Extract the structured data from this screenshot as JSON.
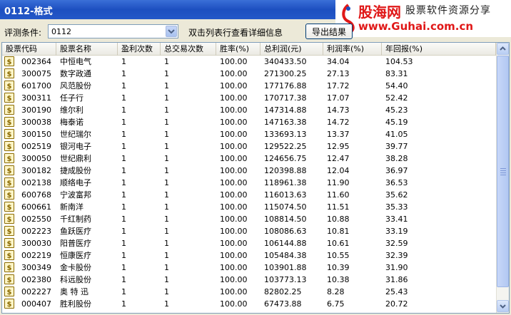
{
  "window": {
    "title": "0112-格式"
  },
  "watermark": {
    "brand": "股海网",
    "slogan": "股票软件资源分享",
    "url": "www.Guhai.com.cn"
  },
  "filter": {
    "label": "评测条件:",
    "value": "0112",
    "hint": "双击列表行查看详细信息"
  },
  "toolbar": {
    "export_label": "导出结果"
  },
  "table": {
    "columns": [
      "股票代码",
      "股票名称",
      "盈利次数",
      "总交易次数",
      "胜率(%)",
      "总利润(元)",
      "利润率(%)",
      "年回报(%)"
    ],
    "rows": [
      [
        "002364",
        "中恒电气",
        "1",
        "1",
        "100.00",
        "340433.50",
        "34.04",
        "104.53"
      ],
      [
        "300075",
        "数字政通",
        "1",
        "1",
        "100.00",
        "271300.25",
        "27.13",
        "83.31"
      ],
      [
        "601700",
        "风范股份",
        "1",
        "1",
        "100.00",
        "177176.88",
        "17.72",
        "54.40"
      ],
      [
        "300311",
        "任子行",
        "1",
        "1",
        "100.00",
        "170717.38",
        "17.07",
        "52.42"
      ],
      [
        "300190",
        "维尔利",
        "1",
        "1",
        "100.00",
        "147314.88",
        "14.73",
        "45.23"
      ],
      [
        "300038",
        "梅泰诺",
        "1",
        "1",
        "100.00",
        "147163.38",
        "14.72",
        "45.19"
      ],
      [
        "300150",
        "世纪瑞尔",
        "1",
        "1",
        "100.00",
        "133693.13",
        "13.37",
        "41.05"
      ],
      [
        "002519",
        "银河电子",
        "1",
        "1",
        "100.00",
        "129522.25",
        "12.95",
        "39.77"
      ],
      [
        "300050",
        "世纪鼎利",
        "1",
        "1",
        "100.00",
        "124656.75",
        "12.47",
        "38.28"
      ],
      [
        "300182",
        "捷成股份",
        "1",
        "1",
        "100.00",
        "120398.88",
        "12.04",
        "36.97"
      ],
      [
        "002138",
        "顺络电子",
        "1",
        "1",
        "100.00",
        "118961.38",
        "11.90",
        "36.53"
      ],
      [
        "600768",
        "宁波富邦",
        "1",
        "1",
        "100.00",
        "116013.63",
        "11.60",
        "35.62"
      ],
      [
        "600661",
        "新南洋",
        "1",
        "1",
        "100.00",
        "115074.50",
        "11.51",
        "35.33"
      ],
      [
        "002550",
        "千红制药",
        "1",
        "1",
        "100.00",
        "108814.50",
        "10.88",
        "33.41"
      ],
      [
        "002223",
        "鱼跃医疗",
        "1",
        "1",
        "100.00",
        "108086.63",
        "10.81",
        "33.19"
      ],
      [
        "300030",
        "阳普医疗",
        "1",
        "1",
        "100.00",
        "106144.88",
        "10.61",
        "32.59"
      ],
      [
        "002219",
        "恒康医疗",
        "1",
        "1",
        "100.00",
        "105484.38",
        "10.55",
        "32.39"
      ],
      [
        "300349",
        "金卡股份",
        "1",
        "1",
        "100.00",
        "103901.88",
        "10.39",
        "31.90"
      ],
      [
        "002380",
        "科远股份",
        "1",
        "1",
        "100.00",
        "103773.13",
        "10.38",
        "31.86"
      ],
      [
        "002227",
        "奥 特 迅",
        "1",
        "1",
        "100.00",
        "82802.25",
        "8.28",
        "25.43"
      ],
      [
        "000407",
        "胜利股份",
        "1",
        "1",
        "100.00",
        "67473.88",
        "6.75",
        "20.72"
      ]
    ]
  },
  "colors": {
    "titlebar": "#2458c8",
    "brand_red": "#e01818",
    "window_bg": "#ece9d8"
  },
  "icons": {
    "row_icon": "dollar-coin-icon",
    "dropdown": "chevron-down-icon"
  }
}
